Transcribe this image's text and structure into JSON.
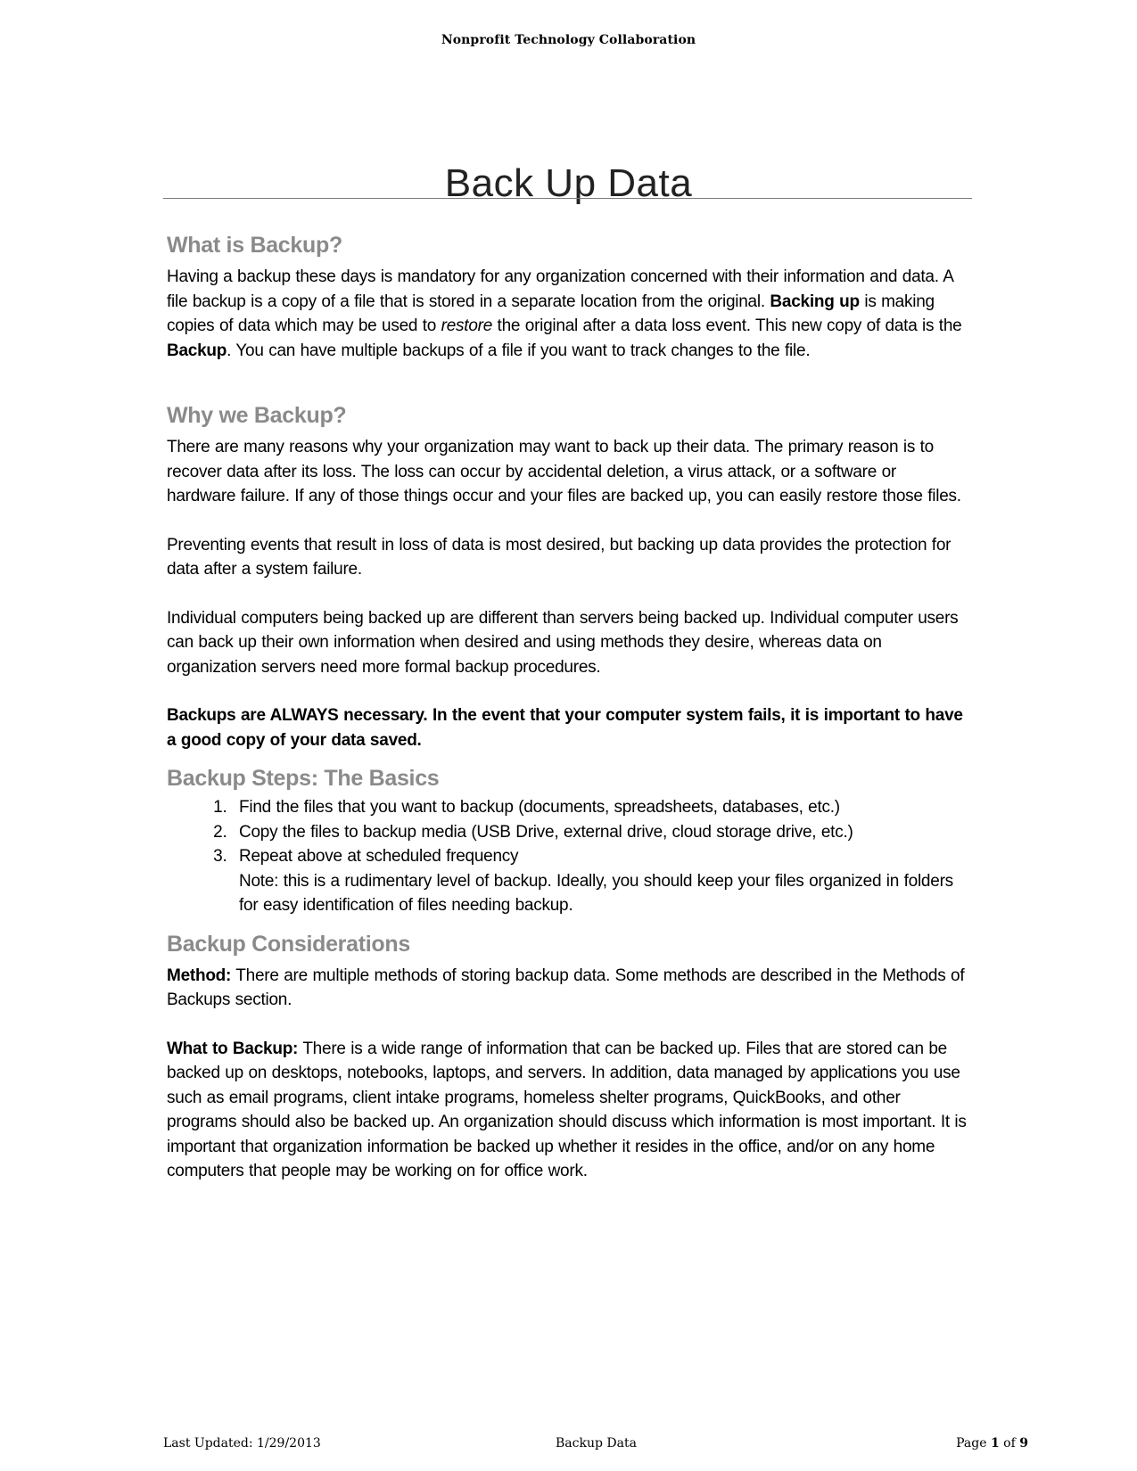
{
  "header": {
    "org": "Nonprofit Technology Collaboration"
  },
  "title": "Back Up Data",
  "sections": {
    "what": {
      "heading": "What is Backup?",
      "p1": {
        "a": "Having a backup these days is mandatory for any organization concerned with their information and data.  A file backup is a copy of a file that is stored in a separate location from the original. ",
        "b_bold": "Backing up",
        "c": " is making copies of data which may be used to ",
        "d_italic": "restore",
        "e": " the original after a data loss event.  This new copy of data is the ",
        "f_bold": "Backup",
        "g": ".  You can have multiple backups of a file if you want to track changes to the file."
      }
    },
    "why": {
      "heading": "Why we Backup?",
      "p1": "There are many reasons why your organization may want to back up their data.  The primary reason is to recover data after its loss.  The loss can occur by accidental deletion, a virus attack, or a software or hardware failure.  If any of those things occur and your files are backed up, you can easily restore those files.",
      "p2": "Preventing events that result in loss of data is most desired, but backing up data provides the protection for data after a system failure.",
      "p3": "Individual computers being backed up are different than servers being backed up.  Individual computer users can back up their own information when desired and using methods they desire, whereas data on organization servers need more formal backup procedures.",
      "p4_bold": "Backups are ALWAYS necessary.  In the event that your computer system fails, it is important to have a good copy of your data saved."
    },
    "steps": {
      "heading": "Backup Steps:  The Basics",
      "items": [
        "Find the files that you want to backup (documents, spreadsheets, databases, etc.)",
        "Copy the files to backup media (USB Drive, external drive, cloud storage drive, etc.)",
        "Repeat above at scheduled frequency"
      ],
      "note": "Note: this is a rudimentary level of backup.  Ideally, you should keep your files organized in folders for easy identification of files needing backup."
    },
    "considerations": {
      "heading": "Backup Considerations",
      "method_label": "Method:",
      "method_text": "  There are multiple methods of storing backup data.  Some methods are described in the Methods of Backups section.",
      "what_label": "What to Backup:",
      "what_text": "  There is a wide range of information that can be backed up.  Files that are stored can be backed up on desktops, notebooks, laptops, and servers.  In addition, data managed by applications you use such as email programs, client intake programs, homeless shelter programs, QuickBooks, and other programs should also be backed up.  An organization should discuss which information is most important.  It is important that organization information be backed up whether it resides in the office, and/or on any home computers that people may be working on for office work."
    }
  },
  "footer": {
    "last_updated": "Last Updated:  1/29/2013",
    "doc_name": "Backup Data",
    "page_prefix": "Page ",
    "page_current": "1",
    "page_of": " of ",
    "page_total": "9"
  }
}
